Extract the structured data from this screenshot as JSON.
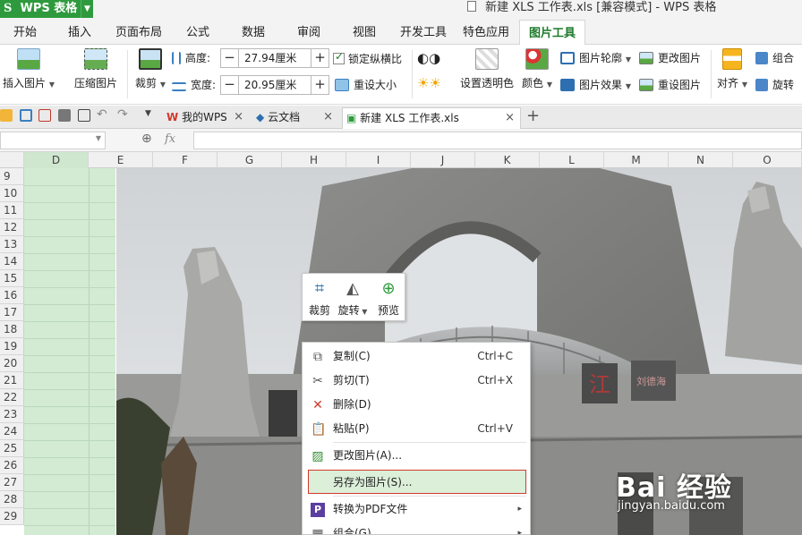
{
  "titlebar": {
    "app_label": "WPS 表格",
    "window_title": "新建 XLS 工作表.xls [兼容模式] - WPS 表格"
  },
  "menu_tabs": [
    "开始",
    "插入",
    "页面布局",
    "公式",
    "数据",
    "审阅",
    "视图",
    "开发工具",
    "特色应用",
    "图片工具"
  ],
  "active_tab": "图片工具",
  "ribbon": {
    "insert_picture": "插入图片",
    "compress_picture": "压缩图片",
    "crop": "裁剪",
    "height_label": "高度:",
    "height_value": "27.94厘米",
    "width_label": "宽度:",
    "width_value": "20.95厘米",
    "lock_ratio": "锁定纵横比",
    "reset_size": "重设大小",
    "set_transparent": "设置透明色",
    "color": "颜色",
    "picture_outline": "图片轮廓",
    "picture_effect": "图片效果",
    "change_picture": "更改图片",
    "reset_picture": "重设图片",
    "align": "对齐",
    "group": "组合",
    "rotate": "旋转"
  },
  "docbar": {
    "tabs": [
      {
        "label": "我的WPS",
        "icon": "wps-logo-icon"
      },
      {
        "label": "云文档",
        "icon": "cloud-doc-icon"
      },
      {
        "label": "新建 XLS 工作表.xls",
        "icon": "sheet-doc-icon"
      }
    ]
  },
  "formula": {
    "name_box": "",
    "fx_label": "fx",
    "content": ""
  },
  "grid": {
    "columns": [
      "D",
      "E",
      "F",
      "G",
      "H",
      "I",
      "J",
      "K",
      "L",
      "M",
      "N",
      "O"
    ],
    "rows": [
      "9",
      "10",
      "11",
      "12",
      "13",
      "14",
      "15",
      "16",
      "17",
      "18",
      "19",
      "20",
      "21",
      "22",
      "23",
      "24",
      "25",
      "26",
      "27",
      "28",
      "29"
    ]
  },
  "mini_toolbar": {
    "crop": "裁剪",
    "rotate": "旋转",
    "preview": "预览"
  },
  "context_menu": {
    "items": [
      {
        "label": "复制(C)",
        "shortcut": "Ctrl+C",
        "icon": "copy-icon"
      },
      {
        "label": "剪切(T)",
        "shortcut": "Ctrl+X",
        "icon": "scissors-icon"
      },
      {
        "label": "删除(D)",
        "shortcut": "",
        "icon": "delete-x-icon"
      },
      {
        "label": "粘贴(P)",
        "shortcut": "Ctrl+V",
        "icon": "paste-icon"
      },
      {
        "label": "更改图片(A)...",
        "shortcut": "",
        "icon": "change-picture-icon"
      },
      {
        "label": "另存为图片(S)...",
        "shortcut": "",
        "icon": "save-as-picture-icon",
        "highlighted": true
      },
      {
        "label": "转换为PDF文件",
        "shortcut": "",
        "icon": "pdf-icon",
        "submenu": true
      },
      {
        "label": "组合(G)",
        "shortcut": "",
        "icon": "group-icon",
        "submenu": true
      }
    ]
  },
  "photo": {
    "sign_text": "江",
    "sign_small": "刘德海"
  },
  "watermark": {
    "brand": "Bai 经验",
    "url": "jingyan.baidu.com"
  },
  "colors": {
    "accent_green": "#2e9a3d",
    "highlight_border": "#d0392b",
    "highlight_fill": "#dcefd9",
    "selected_column": "#d2ebd2"
  }
}
